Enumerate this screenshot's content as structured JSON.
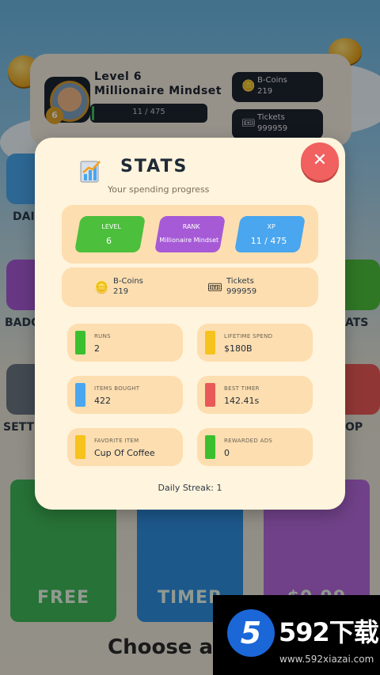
{
  "header": {
    "level": "Level 6",
    "title": "Millionaire Mindset",
    "xp": "11 / 475",
    "avatar_badge": "6",
    "bcoins_label": "B-Coins",
    "bcoins_value": "219",
    "tickets_label": "Tickets",
    "tickets_value": "999959"
  },
  "background": {
    "side_left": [
      "DAI",
      "BADG",
      "SETT"
    ],
    "side_right": [
      "ATS",
      "OP"
    ],
    "cards": [
      "FREE",
      "TIMER",
      "$0.99"
    ],
    "choose_text": "Choose a"
  },
  "modal": {
    "title": "STATS",
    "subtitle": "Your spending progress",
    "close_label": "✕",
    "pills": [
      {
        "label": "LEVEL",
        "value": "6",
        "color": "#4cbf3c"
      },
      {
        "label": "RANK",
        "value": "Millionaire Mindset",
        "color": "#a65ad6"
      },
      {
        "label": "XP",
        "value": "11 / 475",
        "color": "#4aa6ee"
      }
    ],
    "currency": [
      {
        "label": "B-Coins",
        "value": "219",
        "icon": "coins-icon"
      },
      {
        "label": "Tickets",
        "value": "999959",
        "icon": "tickets-icon"
      }
    ],
    "stats": [
      {
        "label": "RUNS",
        "value": "2",
        "color": "#3cbf2e"
      },
      {
        "label": "LIFETIME SPEND",
        "value": "$180B",
        "color": "#f6c21c"
      },
      {
        "label": "ITEMS BOUGHT",
        "value": "422",
        "color": "#4aa6ee"
      },
      {
        "label": "BEST TIMER",
        "value": "142.41s",
        "color": "#e85a57"
      },
      {
        "label": "FAVORITE ITEM",
        "value": "Cup Of Coffee",
        "color": "#f6c21c"
      },
      {
        "label": "REWARDED ADS",
        "value": "0",
        "color": "#3cbf2e"
      }
    ],
    "streak": "Daily Streak: 1"
  },
  "watermark": {
    "logo": "5",
    "brand": "592下载",
    "url": "www.592xiazai.com"
  }
}
